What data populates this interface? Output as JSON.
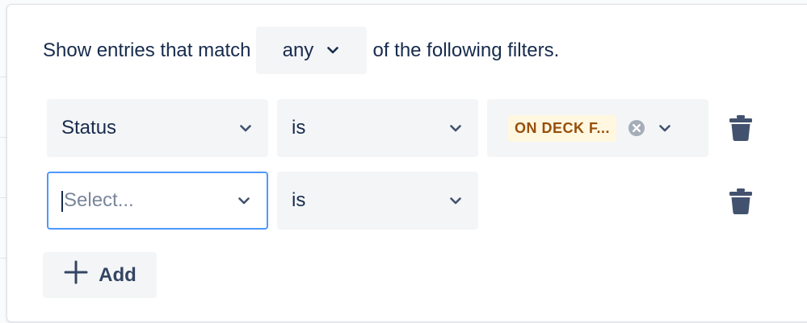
{
  "header": {
    "prefix": "Show entries that match",
    "match_value": "any",
    "suffix": "of the following filters."
  },
  "filters": [
    {
      "field": "Status",
      "operator": "is",
      "value_tag": "ON DECK F..."
    },
    {
      "field_placeholder": "Select...",
      "operator": "is"
    }
  ],
  "add_button": {
    "label": "Add"
  },
  "colors": {
    "text": "#172b4d",
    "field_bg": "#f4f5f7",
    "focus_border": "#4c9aff",
    "tag_bg": "#fff7e0",
    "tag_text": "#974f0c",
    "icon": "#42526e"
  },
  "icons": {
    "dropdown": "chevron-down-icon",
    "clear": "clear-circle-icon",
    "delete": "trash-icon",
    "add": "plus-icon"
  }
}
